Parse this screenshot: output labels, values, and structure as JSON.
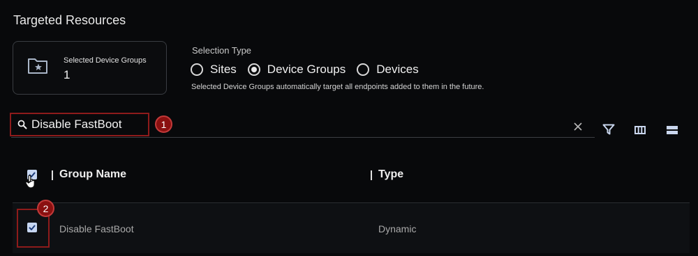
{
  "section": {
    "title": "Targeted Resources"
  },
  "selected_card": {
    "label": "Selected Device Groups",
    "count": "1",
    "icon": "folder-star-icon"
  },
  "selection_type": {
    "label": "Selection Type",
    "options": [
      {
        "label": "Sites",
        "selected": false
      },
      {
        "label": "Device Groups",
        "selected": true
      },
      {
        "label": "Devices",
        "selected": false
      }
    ],
    "hint": "Selected Device Groups automatically target all endpoints added to them in the future."
  },
  "search": {
    "value": "Disable FastBoot",
    "icon": "search-icon"
  },
  "annotations": {
    "badge1": "1",
    "badge2": "2"
  },
  "toolbar": {
    "filter_icon": "filter-icon",
    "columns_icon": "columns-icon",
    "density_icon": "density-icon"
  },
  "table": {
    "columns": [
      "Group Name",
      "Type"
    ],
    "rows": [
      {
        "name": "Disable FastBoot",
        "type": "Dynamic",
        "checked": true
      }
    ]
  },
  "colors": {
    "annotation_red": "#8e1b1b",
    "checkbox": "#c7d7f2",
    "background": "#08090b"
  }
}
